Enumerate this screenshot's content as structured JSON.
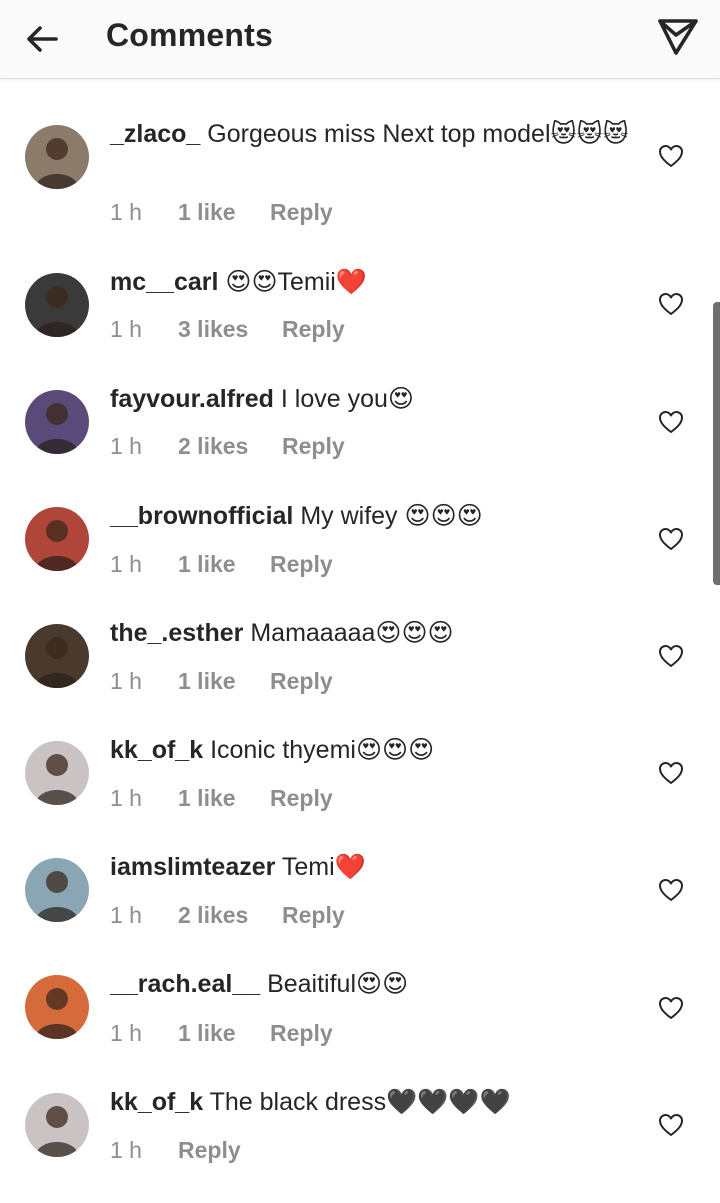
{
  "header": {
    "title": "Comments"
  },
  "comments": [
    {
      "username": "_zlaco_",
      "text": "Gorgeous miss Next top model😻😻😻",
      "time": "1 h",
      "likes": "1 like",
      "reply": "Reply",
      "avatar_bg": "#8a7b6a"
    },
    {
      "username": "mc__carl",
      "text": "😍😍Temii❤️",
      "time": "1 h",
      "likes": "3 likes",
      "reply": "Reply",
      "avatar_bg": "#3a3a3a"
    },
    {
      "username": "fayvour.alfred",
      "text": "I love you😍",
      "time": "1 h",
      "likes": "2 likes",
      "reply": "Reply",
      "avatar_bg": "#5a4a7a"
    },
    {
      "username": "__brownofficial",
      "text": "My wifey 😍😍😍",
      "time": "1 h",
      "likes": "1 like",
      "reply": "Reply",
      "avatar_bg": "#b0453a"
    },
    {
      "username": "the_.esther",
      "text": "Mamaaaaa😍😍😍",
      "time": "1 h",
      "likes": "1 like",
      "reply": "Reply",
      "avatar_bg": "#4a3a2e"
    },
    {
      "username": "kk_of_k",
      "text": "Iconic thyemi😍😍😍",
      "time": "1 h",
      "likes": "1 like",
      "reply": "Reply",
      "avatar_bg": "#c9c3c3"
    },
    {
      "username": "iamslimteazer",
      "text": "Temi❤️",
      "time": "1 h",
      "likes": "2 likes",
      "reply": "Reply",
      "avatar_bg": "#8aa6b5"
    },
    {
      "username": "__rach.eal__",
      "text": "Beaitiful😍😍",
      "time": "1 h",
      "likes": "1 like",
      "reply": "Reply",
      "avatar_bg": "#d56a3b"
    },
    {
      "username": "kk_of_k",
      "text": "The black dress🖤🖤🖤🖤",
      "time": "1 h",
      "likes": "",
      "reply": "Reply",
      "avatar_bg": "#c9c3c3"
    }
  ]
}
